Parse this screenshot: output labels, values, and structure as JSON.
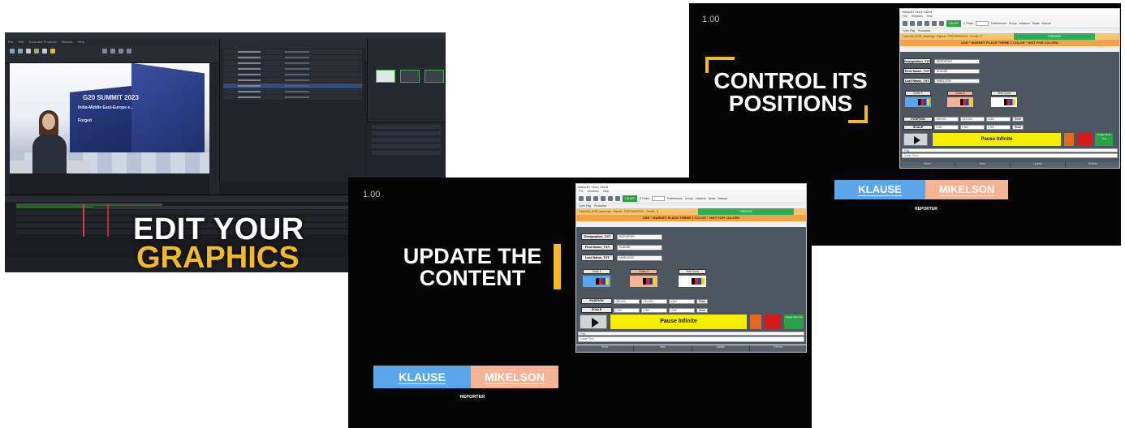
{
  "editor": {
    "menu": [
      "File",
      "Edit",
      "Tools and Products",
      "Window",
      "Help"
    ],
    "viewport": {
      "title": "G20 SUMMIT 2023",
      "subtitle": "India-Middle East-Europe e...",
      "tagline": "Forged"
    },
    "caption_line1": "EDIT YOUR",
    "caption_line2": "GRAPHICS"
  },
  "content_panel": {
    "version": "1.00",
    "caption_line1": "UPDATE THE",
    "caption_line2": "CONTENT"
  },
  "position_panel": {
    "version": "1.00",
    "caption_line1": "CONTROL ITS",
    "caption_line2": "POSITIONS"
  },
  "client": {
    "title": "Wasp3D Story Client",
    "menu": [
      "File",
      "Windows",
      "Help"
    ],
    "on_air": "ON AIR",
    "z_order_label": "Z Order",
    "preferences": "Preferences",
    "group": "Group",
    "instance": "Instance",
    "mode_label": "Mode",
    "mode_value": "Manual",
    "tabs": [
      "Cycle Play",
      "Production"
    ],
    "strip_text": "Lower3rd_MGB_nameorgs : Repeat : TESTMASE0011 : Scrolle : 5",
    "preview_label": "PREVIEW",
    "banner": "USE \" MARKET PLACE THEME 1 COLOR \" HIST FOR COLORS",
    "fields": [
      {
        "label": "Designation_TXT",
        "value": "REPORTER"
      },
      {
        "label": "First Name_TXT",
        "value": "KLAUSE"
      },
      {
        "label": "Last Name_TXT",
        "value": "MIKELSON"
      }
    ],
    "colors": [
      {
        "label": "Color 1",
        "accent": "#5aa6e8"
      },
      {
        "label": "Color 2",
        "accent": "#f4b394"
      },
      {
        "label": "Text Color",
        "accent": "#ffffff"
      }
    ],
    "position_label": "POSITION",
    "position_values": [
      "-390.000",
      "-210.000",
      "0.000"
    ],
    "scale_label": "SCALE",
    "scale_values": [
      "1.000",
      "1.000",
      "1.000"
    ],
    "reset_label": "Reset",
    "pause_label": "Pause Infinite",
    "stop_label": "Stop",
    "out_label": "Out",
    "trigger_label": "Trigger Next Out",
    "log_label": "Play",
    "log_value": "Lower Third",
    "footer": [
      "Reset",
      "Save",
      "Update",
      "Refresh"
    ]
  },
  "lower_third": {
    "first_name": "KLAUSE",
    "last_name": "MIKELSON",
    "designation": "REPORTER"
  },
  "colors": {
    "accent_yellow": "#f2b928",
    "lt_blue": "#5aa6e8",
    "lt_peach": "#f4b394",
    "on_air_green": "#2f9e44",
    "pause_yellow": "#f6ee00"
  }
}
